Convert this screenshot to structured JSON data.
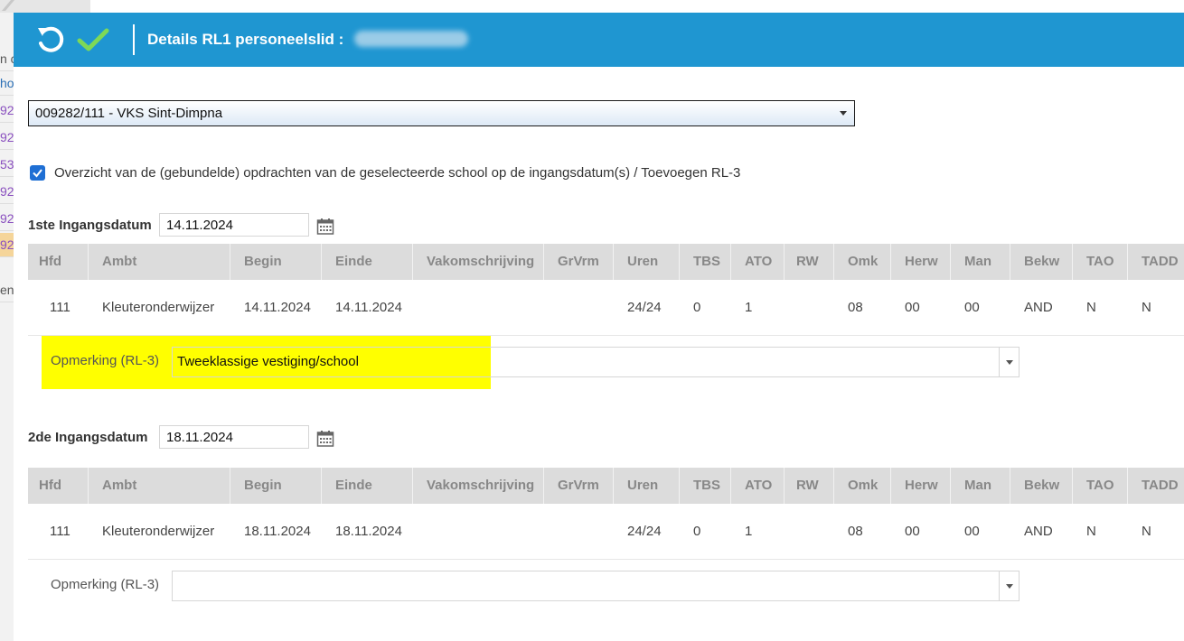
{
  "background": {
    "cells": [
      "n c",
      "ho",
      "92",
      "92",
      "53",
      "92",
      "92",
      "92",
      "en"
    ]
  },
  "header": {
    "title": "Details RL1 personeelslid :",
    "undo_icon": "undo-icon",
    "confirm_icon": "checkmark-icon"
  },
  "school_select": {
    "value": "009282/111 - VKS Sint-Dimpna"
  },
  "overview_checkbox": {
    "checked": true,
    "label": "Overzicht van de (gebundelde) opdrachten van de geselecteerde school op de ingangsdatum(s) / Toevoegen RL-3"
  },
  "columns": [
    "Hfd",
    "Ambt",
    "Begin",
    "Einde",
    "Vakomschrijving",
    "GrVrm",
    "Uren",
    "TBS",
    "ATO",
    "RW",
    "Omk",
    "Herw",
    "Man",
    "Bekw",
    "TAO",
    "TADD"
  ],
  "sections": [
    {
      "date_label": "1ste Ingangsdatum",
      "date_value": "14.11.2024",
      "row": [
        "111",
        "Kleuteronderwijzer",
        "14.11.2024",
        "14.11.2024",
        "",
        "",
        "24/24",
        "0",
        "1",
        "",
        "08",
        "00",
        "00",
        "AND",
        "N",
        "N"
      ],
      "remark_label": "Opmerking (RL-3)",
      "remark_value": "Tweeklassige vestiging/school"
    },
    {
      "date_label": "2de Ingangsdatum",
      "date_value": "18.11.2024",
      "row": [
        "111",
        "Kleuteronderwijzer",
        "18.11.2024",
        "18.11.2024",
        "",
        "",
        "24/24",
        "0",
        "1",
        "",
        "08",
        "00",
        "00",
        "AND",
        "N",
        "N"
      ],
      "remark_label": "Opmerking (RL-3)",
      "remark_value": ""
    }
  ],
  "colors": {
    "header_bg": "#1f96d1",
    "highlight": "#ffff00",
    "checkmark": "#7ed957",
    "checkbox": "#1f6fd4"
  }
}
